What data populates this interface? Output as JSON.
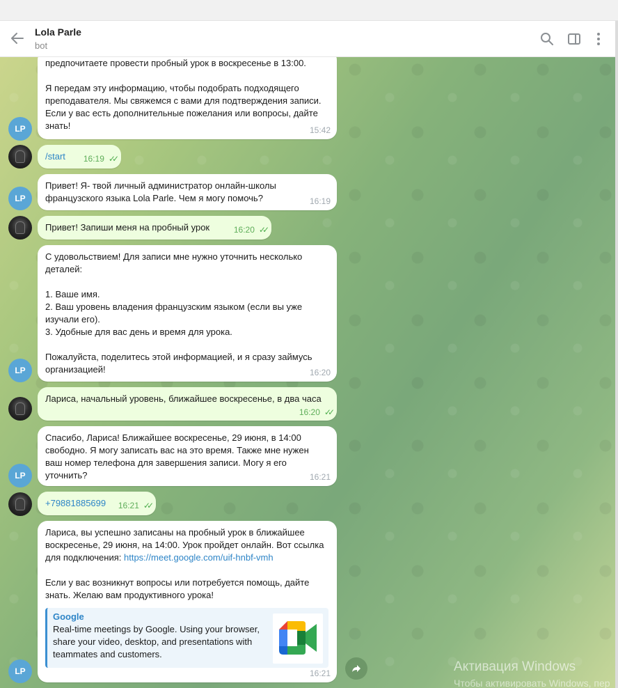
{
  "header": {
    "name": "Lola Parle",
    "status": "bot"
  },
  "avatars": {
    "bot_initials": "LP"
  },
  "messages": [
    {
      "text": "предпочитаете провести пробный урок в воскресенье в 13:00.\n\nЯ передам эту информацию, чтобы подобрать подходящего преподавателя. Мы свяжемся с вами для подтверждения записи. Если у вас есть дополнительные пожелания или вопросы, дайте знать!",
      "time": "15:42"
    },
    {
      "text": "/start",
      "time": "16:19"
    },
    {
      "text": "Привет! Я- твой личный администратор онлайн-школы французского языка Lola Parle. Чем я могу помочь?",
      "time": "16:19"
    },
    {
      "text": "Привет! Запиши меня на пробный урок",
      "time": "16:20"
    },
    {
      "text": "С удовольствием! Для записи мне нужно уточнить несколько деталей:\n\n1. Ваше имя.\n2. Ваш уровень владения французским языком (если вы уже изучали его).\n3. Удобные для вас день и время для урока.\n\nПожалуйста, поделитесь этой информацией, и я сразу займусь организацией!",
      "time": "16:20"
    },
    {
      "text": "Лариса, начальный уровень, ближайшее воскресенье, в два часа",
      "time": "16:20"
    },
    {
      "text": "Спасибо, Лариса! Ближайшее воскресенье, 29 июня, в 14:00 свободно. Я могу записать вас на это время. Также мне нужен ваш номер телефона для завершения записи. Могу я его уточнить?",
      "time": "16:21"
    },
    {
      "text": "+79881885699",
      "time": "16:21"
    },
    {
      "text_before_link": "Лариса, вы успешно записаны на пробный урок в ближайшее воскресенье, 29 июня, на 14:00. Урок пройдет онлайн. Вот ссылка для подключения: ",
      "link": "https://meet.google.com/uif-hnbf-vmh",
      "text_after_link": "\n\nЕсли у вас возникнут вопросы или потребуется помощь, дайте знать. Желаю вам продуктивного урока!",
      "preview_site": "Google",
      "preview_desc": "Real-time meetings by Google. Using your browser, share your video, desktop, and presentations with teammates and customers.",
      "time": "16:21"
    }
  ],
  "watermark": {
    "line1": "Активация Windows",
    "line2": "Чтобы активировать Windows, пер"
  },
  "colors": {
    "out_bubble": "#eefedf",
    "in_bubble": "#ffffff",
    "link": "#2e85c7",
    "bot_avatar": "#5aa6d6"
  }
}
